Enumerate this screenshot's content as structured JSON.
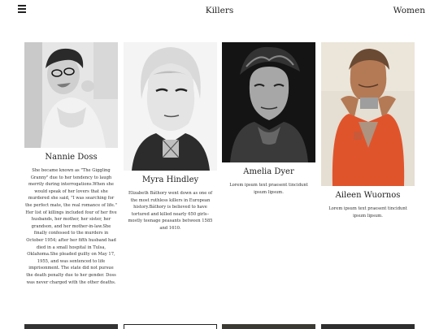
{
  "header": {
    "title": "Killers",
    "nav_link": "Women"
  },
  "cards": [
    {
      "name": "Nannie Doss",
      "text": "She became known as \"The Giggling Granny\" due to her tendency to laugh merrily during interrogations.When she would speak of her lovers that she murdered she said, \"I was searching for the perfect mate, the real romance of life.\" Her list of killings included four of her five husbands, her mother, her sister, her grandson, and her mother-in-law.She finally confessed to the murders in October 1954; after her fifth husband had died in a small hospital in Tulsa, Oklahoma.She pleaded guilty on May 17, 1955, and was sentenced to life imprisonment. The state did not pursue the death penalty due to her gender. Doss was never charged with the other deaths."
    },
    {
      "name": "Myra Hindley",
      "text": "Elizabeth Báthory went down as one of the most ruthless killers in European history.Báthory is believed to have tortured and killed nearly 650 girls– mostly teenage peasants between 1585 and 1610."
    },
    {
      "name": "Amelia Dyer",
      "text": "Lorem ipsum text praesent tincidunt ipsum lipsum."
    },
    {
      "name": "Aileen Wuornos",
      "text": "Lorem ipsum text praesent tincidunt ipsum lipsum."
    }
  ]
}
